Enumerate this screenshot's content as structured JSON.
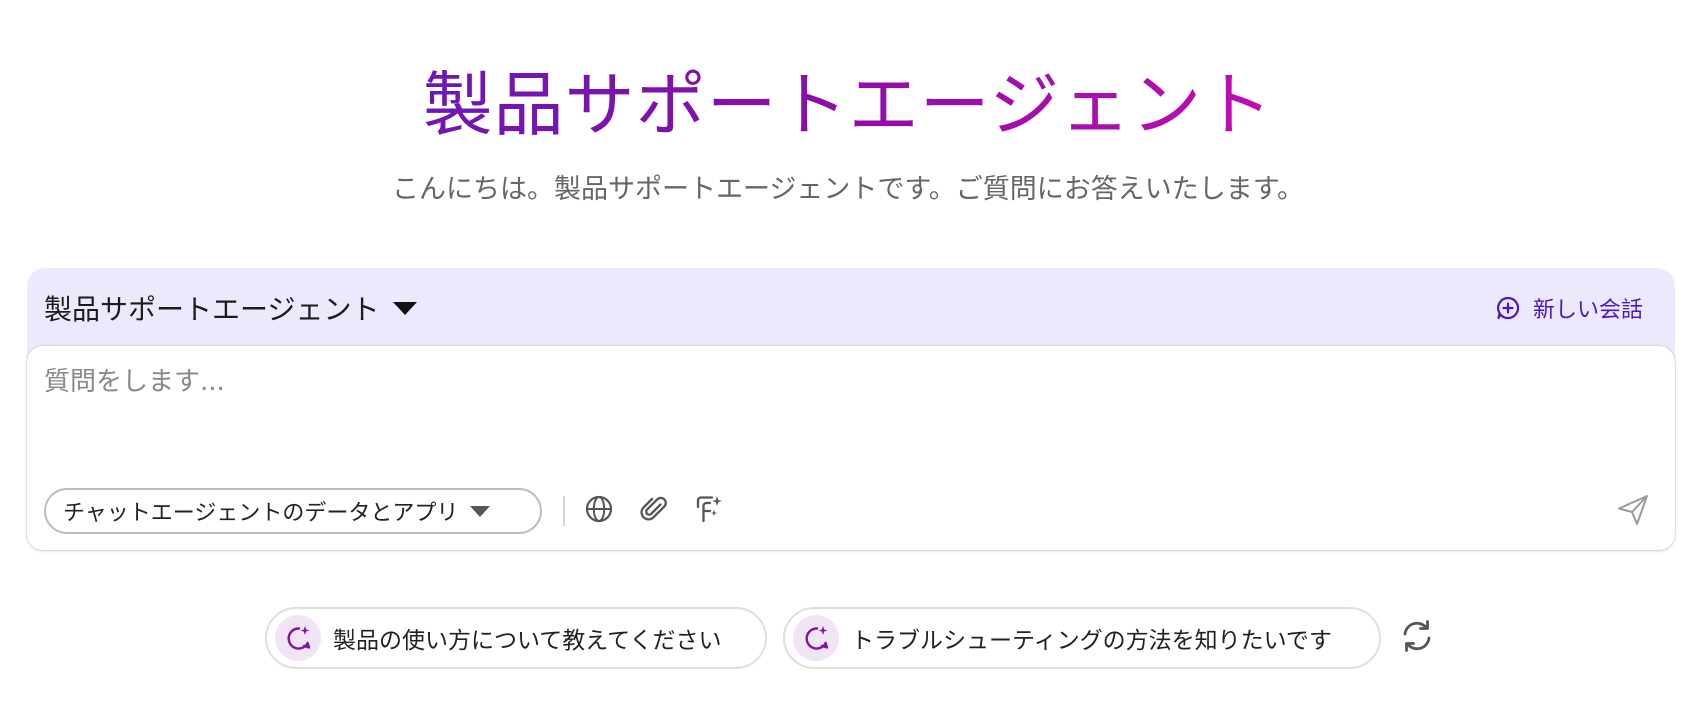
{
  "header": {
    "title": "製品サポートエージェント",
    "subtitle": "こんにちは。製品サポートエージェントです。ご質問にお答えいたします。"
  },
  "agent_selector": {
    "label": "製品サポートエージェント",
    "icon": "chevron-down-icon"
  },
  "new_chat": {
    "label": "新しい会話",
    "icon": "chat-plus-icon"
  },
  "composer": {
    "placeholder": "質問をします...",
    "value": "",
    "source_select": {
      "selected": "チャットエージェントのデータとアプリ",
      "icon": "chevron-down-icon"
    },
    "tools": [
      {
        "name": "web-search",
        "icon": "globe-icon"
      },
      {
        "name": "attach",
        "icon": "paperclip-icon"
      },
      {
        "name": "prompt-library",
        "icon": "sparkle-format-icon"
      }
    ],
    "send_icon": "send-icon"
  },
  "suggestions": [
    {
      "label": "製品の使い方について教えてください",
      "icon": "sparkle-chat-icon"
    },
    {
      "label": "トラブルシューティングの方法を知りたいです",
      "icon": "sparkle-chat-icon"
    }
  ],
  "refresh_icon": "refresh-icon",
  "colors": {
    "title_gradient_start": "#6e16b5",
    "title_gradient_end": "#c20bb3",
    "accent": "#4a18c8",
    "panel_background": "#ece9fd",
    "suggestion_icon_background": "#f1e4f4"
  }
}
